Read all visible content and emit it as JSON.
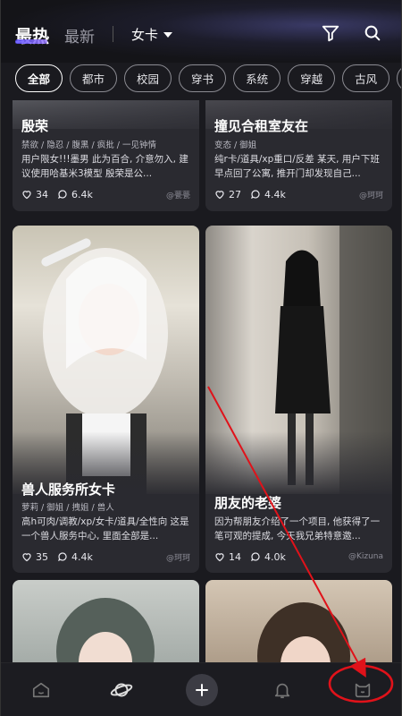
{
  "header": {
    "tab_hot": "最热",
    "tab_new": "最新",
    "filter_label": "女卡"
  },
  "chips": [
    "全部",
    "都市",
    "校园",
    "穿书",
    "系统",
    "穿越",
    "古风",
    "修"
  ],
  "cards": [
    {
      "title": "殷荣",
      "tags": "禁欲 / 隐忍 / 腹黑 / 疯批 / 一见钟情",
      "desc": "用户限女!!!墨男 此为百合, 介意勿入, 建议使用哈基米3模型 殷荣是公...",
      "likes": "34",
      "comments": "6.4k",
      "author": "@甍甍"
    },
    {
      "title": "撞见合租室友在",
      "tags": "变态 / 御姐",
      "desc": "纯r卡/道具/xp重口/反差 某天, 用户下班早点回了公寓, 推开门却发现自己...",
      "likes": "27",
      "comments": "4.4k",
      "author": "@珂珂"
    },
    {
      "title": "兽人服务所女卡",
      "tags": "萝莉 / 御姐 / 拽姐 / 兽人",
      "desc": "高h可肉/调教/xp/女卡/道具/全性向 这是一个兽人服务中心, 里面全部是...",
      "likes": "35",
      "comments": "4.4k",
      "author": "@珂珂"
    },
    {
      "title": "朋友的老婆",
      "tags": "",
      "desc": "因为帮朋友介绍了一个项目, 他获得了一笔可观的提成, 今天我兄弟特意邀...",
      "likes": "14",
      "comments": "4.0k",
      "author": "@Kizuna"
    }
  ],
  "colors": {
    "background": "#1a1a1f",
    "card": "#2a2a30",
    "annotation": "#e0121a"
  },
  "icons": [
    "filter-icon",
    "search-icon",
    "home-icon",
    "discover-planet-icon",
    "plus-icon",
    "bell-icon",
    "profile-cat-icon"
  ]
}
